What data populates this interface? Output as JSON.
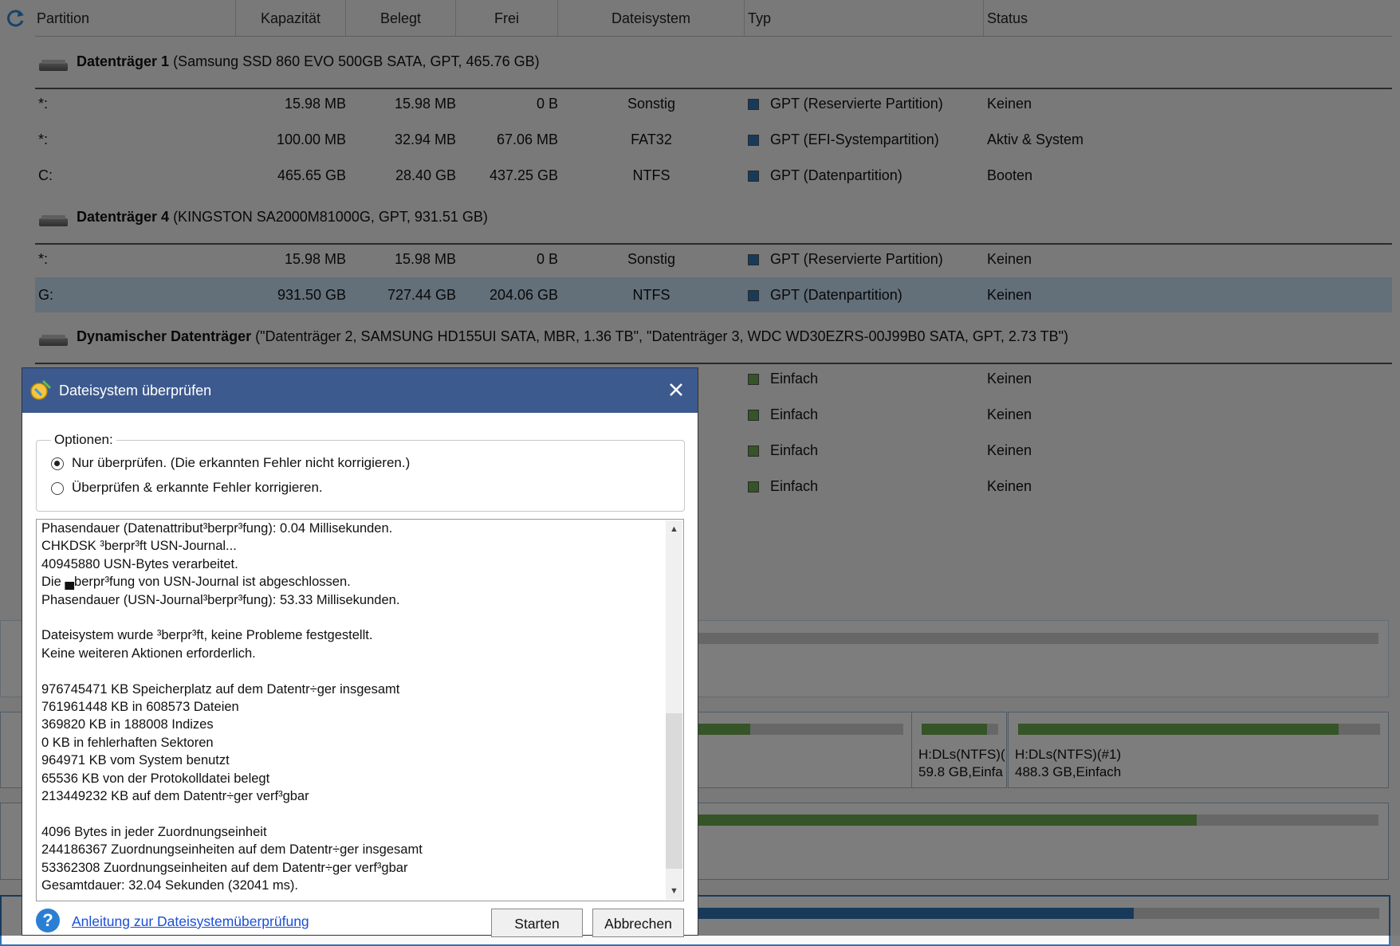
{
  "columns": [
    "Partition",
    "Kapazität",
    "Belegt",
    "Frei",
    "Dateisystem",
    "Typ",
    "Status"
  ],
  "disks": [
    {
      "name": "Datenträger 1",
      "detail": "(Samsung SSD 860 EVO 500GB SATA, GPT, 465.76 GB)"
    },
    {
      "name": "Datenträger 4",
      "detail": "(KINGSTON SA2000M81000G, GPT, 931.51 GB)"
    },
    {
      "name": "Dynamischer Datenträger",
      "detail": "(\"Datenträger 2, SAMSUNG HD155UI SATA, MBR, 1.36 TB\", \"Datenträger 3, WDC WD30EZRS-00J99B0 SATA, GPT, 2.73 TB\")"
    }
  ],
  "rows": [
    {
      "partition": "*:",
      "capacity": "15.98 MB",
      "used": "15.98 MB",
      "free": "0 B",
      "fs": "Sonstig",
      "type": "GPT (Reservierte Partition)",
      "status": "Keinen",
      "color": "#2e75b6"
    },
    {
      "partition": "*:",
      "capacity": "100.00 MB",
      "used": "32.94 MB",
      "free": "67.06 MB",
      "fs": "FAT32",
      "type": "GPT (EFI-Systempartition)",
      "status": "Aktiv & System",
      "color": "#2e75b6"
    },
    {
      "partition": "C:",
      "capacity": "465.65 GB",
      "used": "28.40 GB",
      "free": "437.25 GB",
      "fs": "NTFS",
      "type": "GPT (Datenpartition)",
      "status": "Booten",
      "color": "#2e75b6"
    },
    {
      "partition": "*:",
      "capacity": "15.98 MB",
      "used": "15.98 MB",
      "free": "0 B",
      "fs": "Sonstig",
      "type": "GPT (Reservierte Partition)",
      "status": "Keinen",
      "color": "#2e75b6"
    },
    {
      "partition": "G:",
      "capacity": "931.50 GB",
      "used": "727.44 GB",
      "free": "204.06 GB",
      "fs": "NTFS",
      "type": "GPT (Datenpartition)",
      "status": "Keinen",
      "color": "#2e75b6"
    },
    {
      "type": "Einfach",
      "status": "Keinen",
      "color": "#6aa84f"
    },
    {
      "type": "Einfach",
      "status": "Keinen",
      "color": "#6aa84f"
    },
    {
      "type": "Einfach",
      "status": "Keinen",
      "color": "#6aa84f"
    },
    {
      "type": "Einfach",
      "status": "Keinen",
      "color": "#6aa84f"
    }
  ],
  "map": {
    "h_small_label": "H:DLs(NTFS)(",
    "h_small_size": "59.8 GB,Einfa",
    "h_big_label": "H:DLs(NTFS)(#1)",
    "h_big_size": "488.3 GB,Einfach"
  },
  "dialog": {
    "title": "Dateisystem überprüfen",
    "options_label": "Optionen:",
    "option1": "Nur überprüfen. (Die erkannten Fehler nicht korrigieren.)",
    "option2": "Überprüfen & erkannte Fehler korrigieren.",
    "log": [
      "Phasendauer (Datenattribut³berpr³fung): 0.04 Millisekunden.",
      "CHKDSK ³berpr³ft USN-Journal...",
      "40945880 USN-Bytes verarbeitet.",
      "Die ▄berpr³fung von USN-Journal ist abgeschlossen.",
      "Phasendauer (USN-Journal³berpr³fung): 53.33 Millisekunden.",
      "",
      "Dateisystem wurde ³berpr³ft, keine Probleme festgestellt.",
      "Keine weiteren Aktionen erforderlich.",
      "",
      "976745471 KB Speicherplatz auf dem Datentr÷ger insgesamt",
      "761961448 KB in 608573 Dateien",
      "369820 KB in 188008 Indizes",
      "0 KB in fehlerhaften Sektoren",
      "964971 KB vom System benutzt",
      "65536 KB von der Protokolldatei belegt",
      "213449232 KB auf dem Datentr÷ger verf³gbar",
      "",
      "4096 Bytes in jeder Zuordnungseinheit",
      "244186367 Zuordnungseinheiten auf dem Datentr÷ger insgesamt",
      "53362308 Zuordnungseinheiten auf dem Datentr÷ger verf³gbar",
      "Gesamtdauer: 32.04 Sekunden (32041 ms)."
    ],
    "help_link": "Anleitung zur Dateisystemüberprüfung",
    "start_button": "Starten",
    "cancel_button": "Abbrechen"
  }
}
